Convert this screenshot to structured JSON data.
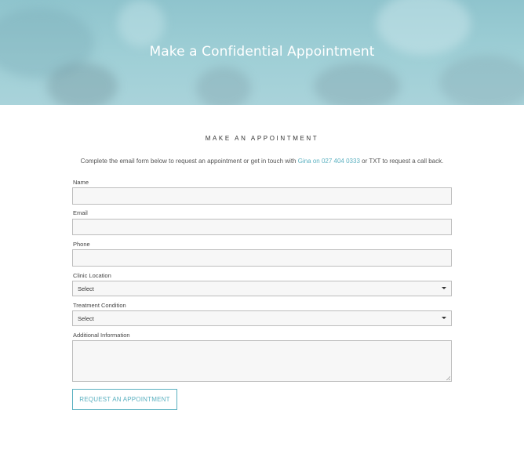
{
  "hero": {
    "title": "Make a Confidential Appointment"
  },
  "form": {
    "heading": "MAKE AN APPOINTMENT",
    "intro_prefix": "Complete the email form below to request an appointment or get in touch with ",
    "intro_link": "Gina on 027 404 0333",
    "intro_suffix": " or TXT to request a call back.",
    "fields": {
      "name": {
        "label": "Name",
        "value": ""
      },
      "email": {
        "label": "Email",
        "value": ""
      },
      "phone": {
        "label": "Phone",
        "value": ""
      },
      "clinic_location": {
        "label": "Clinic Location",
        "selected": "Select"
      },
      "treatment_condition": {
        "label": "Treatment Condition",
        "selected": "Select"
      },
      "additional_info": {
        "label": "Additional Information",
        "value": ""
      }
    },
    "submit_label": "REQUEST AN APPOINTMENT"
  },
  "colors": {
    "accent": "#5ab0c0",
    "hero_bg": "#9fcfd6",
    "field_bg": "#f7f7f7",
    "field_border": "#bdbdbd"
  },
  "icons": {
    "select_caret": "caret-down-icon",
    "textarea_grip": "resize-grip-icon"
  }
}
